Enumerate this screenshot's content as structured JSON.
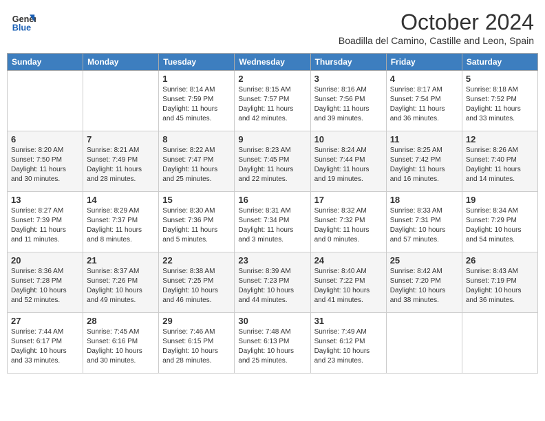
{
  "header": {
    "logo_line1": "General",
    "logo_line2": "Blue",
    "month": "October 2024",
    "location": "Boadilla del Camino, Castille and Leon, Spain"
  },
  "days_of_week": [
    "Sunday",
    "Monday",
    "Tuesday",
    "Wednesday",
    "Thursday",
    "Friday",
    "Saturday"
  ],
  "weeks": [
    [
      {
        "day": "",
        "info": ""
      },
      {
        "day": "",
        "info": ""
      },
      {
        "day": "1",
        "info": "Sunrise: 8:14 AM\nSunset: 7:59 PM\nDaylight: 11 hours and 45 minutes."
      },
      {
        "day": "2",
        "info": "Sunrise: 8:15 AM\nSunset: 7:57 PM\nDaylight: 11 hours and 42 minutes."
      },
      {
        "day": "3",
        "info": "Sunrise: 8:16 AM\nSunset: 7:56 PM\nDaylight: 11 hours and 39 minutes."
      },
      {
        "day": "4",
        "info": "Sunrise: 8:17 AM\nSunset: 7:54 PM\nDaylight: 11 hours and 36 minutes."
      },
      {
        "day": "5",
        "info": "Sunrise: 8:18 AM\nSunset: 7:52 PM\nDaylight: 11 hours and 33 minutes."
      }
    ],
    [
      {
        "day": "6",
        "info": "Sunrise: 8:20 AM\nSunset: 7:50 PM\nDaylight: 11 hours and 30 minutes."
      },
      {
        "day": "7",
        "info": "Sunrise: 8:21 AM\nSunset: 7:49 PM\nDaylight: 11 hours and 28 minutes."
      },
      {
        "day": "8",
        "info": "Sunrise: 8:22 AM\nSunset: 7:47 PM\nDaylight: 11 hours and 25 minutes."
      },
      {
        "day": "9",
        "info": "Sunrise: 8:23 AM\nSunset: 7:45 PM\nDaylight: 11 hours and 22 minutes."
      },
      {
        "day": "10",
        "info": "Sunrise: 8:24 AM\nSunset: 7:44 PM\nDaylight: 11 hours and 19 minutes."
      },
      {
        "day": "11",
        "info": "Sunrise: 8:25 AM\nSunset: 7:42 PM\nDaylight: 11 hours and 16 minutes."
      },
      {
        "day": "12",
        "info": "Sunrise: 8:26 AM\nSunset: 7:40 PM\nDaylight: 11 hours and 14 minutes."
      }
    ],
    [
      {
        "day": "13",
        "info": "Sunrise: 8:27 AM\nSunset: 7:39 PM\nDaylight: 11 hours and 11 minutes."
      },
      {
        "day": "14",
        "info": "Sunrise: 8:29 AM\nSunset: 7:37 PM\nDaylight: 11 hours and 8 minutes."
      },
      {
        "day": "15",
        "info": "Sunrise: 8:30 AM\nSunset: 7:36 PM\nDaylight: 11 hours and 5 minutes."
      },
      {
        "day": "16",
        "info": "Sunrise: 8:31 AM\nSunset: 7:34 PM\nDaylight: 11 hours and 3 minutes."
      },
      {
        "day": "17",
        "info": "Sunrise: 8:32 AM\nSunset: 7:32 PM\nDaylight: 11 hours and 0 minutes."
      },
      {
        "day": "18",
        "info": "Sunrise: 8:33 AM\nSunset: 7:31 PM\nDaylight: 10 hours and 57 minutes."
      },
      {
        "day": "19",
        "info": "Sunrise: 8:34 AM\nSunset: 7:29 PM\nDaylight: 10 hours and 54 minutes."
      }
    ],
    [
      {
        "day": "20",
        "info": "Sunrise: 8:36 AM\nSunset: 7:28 PM\nDaylight: 10 hours and 52 minutes."
      },
      {
        "day": "21",
        "info": "Sunrise: 8:37 AM\nSunset: 7:26 PM\nDaylight: 10 hours and 49 minutes."
      },
      {
        "day": "22",
        "info": "Sunrise: 8:38 AM\nSunset: 7:25 PM\nDaylight: 10 hours and 46 minutes."
      },
      {
        "day": "23",
        "info": "Sunrise: 8:39 AM\nSunset: 7:23 PM\nDaylight: 10 hours and 44 minutes."
      },
      {
        "day": "24",
        "info": "Sunrise: 8:40 AM\nSunset: 7:22 PM\nDaylight: 10 hours and 41 minutes."
      },
      {
        "day": "25",
        "info": "Sunrise: 8:42 AM\nSunset: 7:20 PM\nDaylight: 10 hours and 38 minutes."
      },
      {
        "day": "26",
        "info": "Sunrise: 8:43 AM\nSunset: 7:19 PM\nDaylight: 10 hours and 36 minutes."
      }
    ],
    [
      {
        "day": "27",
        "info": "Sunrise: 7:44 AM\nSunset: 6:17 PM\nDaylight: 10 hours and 33 minutes."
      },
      {
        "day": "28",
        "info": "Sunrise: 7:45 AM\nSunset: 6:16 PM\nDaylight: 10 hours and 30 minutes."
      },
      {
        "day": "29",
        "info": "Sunrise: 7:46 AM\nSunset: 6:15 PM\nDaylight: 10 hours and 28 minutes."
      },
      {
        "day": "30",
        "info": "Sunrise: 7:48 AM\nSunset: 6:13 PM\nDaylight: 10 hours and 25 minutes."
      },
      {
        "day": "31",
        "info": "Sunrise: 7:49 AM\nSunset: 6:12 PM\nDaylight: 10 hours and 23 minutes."
      },
      {
        "day": "",
        "info": ""
      },
      {
        "day": "",
        "info": ""
      }
    ]
  ]
}
